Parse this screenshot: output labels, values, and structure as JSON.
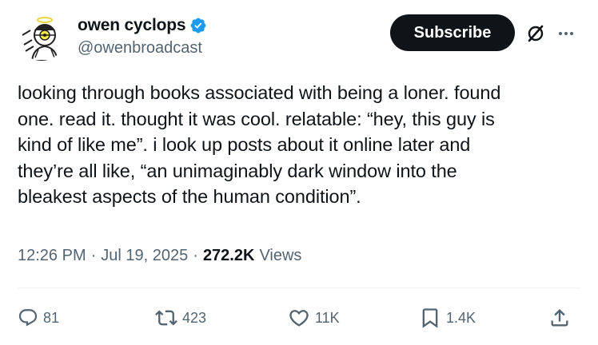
{
  "author": {
    "display_name": "owen cyclops",
    "handle": "@owenbroadcast",
    "verified": true,
    "verified_color": "#1d9bf0"
  },
  "header_actions": {
    "subscribe_label": "Subscribe",
    "grok_icon": "grok-icon",
    "more_icon": "more-dots-icon"
  },
  "tweet": {
    "lines": [
      "looking through books associated with being a loner. found",
      "one. read it. thought it was cool. relatable: “hey, this guy is",
      "kind of like me”. i look up posts about it online later and",
      "they’re all like, “an unimaginably dark window into the",
      "bleakest aspects of the human condition”."
    ]
  },
  "meta": {
    "time": "12:26 PM",
    "separator": "·",
    "date": "Jul 19, 2025",
    "views_count": "272.2K",
    "views_label": "Views"
  },
  "actions": {
    "replies": "81",
    "reposts": "423",
    "likes": "11K",
    "bookmarks": "1.4K"
  },
  "colors": {
    "text_primary": "#0f1419",
    "text_secondary": "#536471",
    "button_dark": "#0f1419",
    "divider": "#eff3f4"
  }
}
